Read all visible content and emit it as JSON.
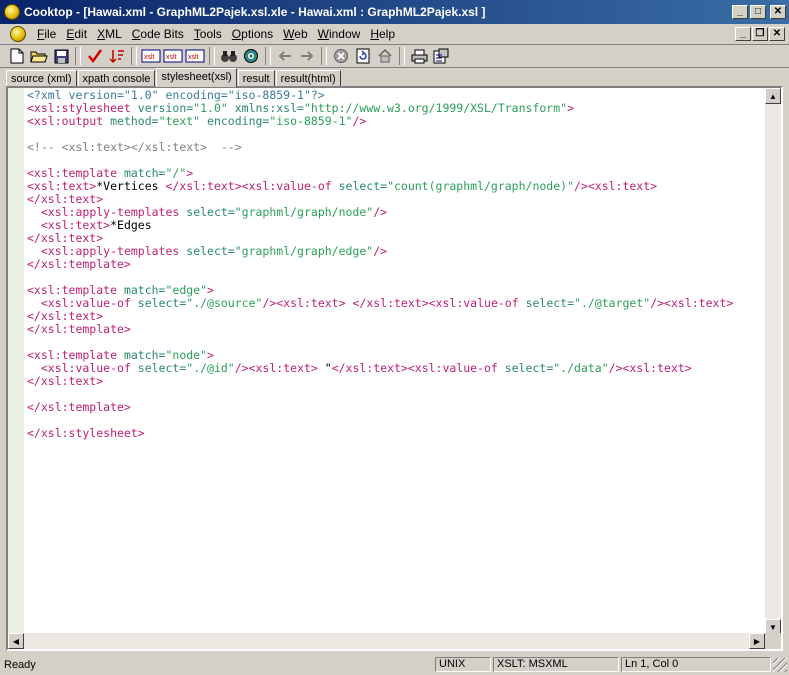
{
  "window": {
    "title": "Cooktop - [Hawai.xml - GraphML2Pajek.xsl.xle - Hawai.xml : GraphML2Pajek.xsl ]",
    "app_icon": "cooktop-logo-icon"
  },
  "menu": {
    "items": [
      "File",
      "Edit",
      "XML",
      "Code Bits",
      "Tools",
      "Options",
      "Web",
      "Window",
      "Help"
    ]
  },
  "toolbar": {
    "xslt_label": "xslt"
  },
  "tabs": [
    {
      "label": "source (xml)",
      "active": false
    },
    {
      "label": "xpath console",
      "active": false
    },
    {
      "label": "stylesheet(xsl)",
      "active": true
    },
    {
      "label": "result",
      "active": false
    },
    {
      "label": "result(html)",
      "active": false
    }
  ],
  "editor": {
    "lines": [
      [
        [
          "pi",
          "<?xml version=\"1.0\" encoding=\"iso-8859-1\"?>"
        ]
      ],
      [
        [
          "tag",
          "<xsl:stylesheet "
        ],
        [
          "attr",
          "version="
        ],
        [
          "str",
          "\"1.0\" "
        ],
        [
          "attr",
          "xmlns:xsl="
        ],
        [
          "str",
          "\"http://www.w3.org/1999/XSL/Transform\""
        ],
        [
          "tag",
          ">"
        ]
      ],
      [
        [
          "tag",
          "<xsl:output "
        ],
        [
          "attr",
          "method="
        ],
        [
          "str",
          "\"text\" "
        ],
        [
          "attr",
          "encoding="
        ],
        [
          "str",
          "\"iso-8859-1\""
        ],
        [
          "tag",
          "/>"
        ]
      ],
      [],
      [
        [
          "com",
          "<!-- <xsl:text></xsl:text>  -->"
        ]
      ],
      [],
      [
        [
          "tag",
          "<xsl:template "
        ],
        [
          "attr",
          "match="
        ],
        [
          "str",
          "\"/\""
        ],
        [
          "tag",
          ">"
        ]
      ],
      [
        [
          "tag",
          "<xsl:text>"
        ],
        [
          "text",
          "*Vertices "
        ],
        [
          "tag",
          "</xsl:text><xsl:value-of "
        ],
        [
          "attr",
          "select="
        ],
        [
          "str",
          "\"count(graphml/graph/node)\""
        ],
        [
          "tag",
          "/><xsl:text>"
        ]
      ],
      [
        [
          "tag",
          "</xsl:text>"
        ]
      ],
      [
        [
          "text",
          "  "
        ],
        [
          "tag",
          "<xsl:apply-templates "
        ],
        [
          "attr",
          "select="
        ],
        [
          "str",
          "\"graphml/graph/node\""
        ],
        [
          "tag",
          "/>"
        ]
      ],
      [
        [
          "text",
          "  "
        ],
        [
          "tag",
          "<xsl:text>"
        ],
        [
          "text",
          "*Edges"
        ]
      ],
      [
        [
          "tag",
          "</xsl:text>"
        ]
      ],
      [
        [
          "text",
          "  "
        ],
        [
          "tag",
          "<xsl:apply-templates "
        ],
        [
          "attr",
          "select="
        ],
        [
          "str",
          "\"graphml/graph/edge\""
        ],
        [
          "tag",
          "/>"
        ]
      ],
      [
        [
          "tag",
          "</xsl:template>"
        ]
      ],
      [],
      [
        [
          "tag",
          "<xsl:template "
        ],
        [
          "attr",
          "match="
        ],
        [
          "str",
          "\"edge\""
        ],
        [
          "tag",
          ">"
        ]
      ],
      [
        [
          "text",
          "  "
        ],
        [
          "tag",
          "<xsl:value-of "
        ],
        [
          "attr",
          "select="
        ],
        [
          "str",
          "\"./@source\""
        ],
        [
          "tag",
          "/><xsl:text>"
        ],
        [
          "text",
          " "
        ],
        [
          "tag",
          "</xsl:text><xsl:value-of "
        ],
        [
          "attr",
          "select="
        ],
        [
          "str",
          "\"./@target\""
        ],
        [
          "tag",
          "/><xsl:text>"
        ]
      ],
      [
        [
          "tag",
          "</xsl:text>"
        ]
      ],
      [
        [
          "tag",
          "</xsl:template>"
        ]
      ],
      [],
      [
        [
          "tag",
          "<xsl:template "
        ],
        [
          "attr",
          "match="
        ],
        [
          "str",
          "\"node\""
        ],
        [
          "tag",
          ">"
        ]
      ],
      [
        [
          "text",
          "  "
        ],
        [
          "tag",
          "<xsl:value-of "
        ],
        [
          "attr",
          "select="
        ],
        [
          "str",
          "\"./@id\""
        ],
        [
          "tag",
          "/><xsl:text>"
        ],
        [
          "text",
          " \""
        ],
        [
          "tag",
          "</xsl:text><xsl:value-of "
        ],
        [
          "attr",
          "select="
        ],
        [
          "str",
          "\"./data\""
        ],
        [
          "tag",
          "/><xsl:text>"
        ]
      ],
      [
        [
          "tag",
          "</xsl:text>"
        ]
      ],
      [],
      [
        [
          "tag",
          "</xsl:template>"
        ]
      ],
      [],
      [
        [
          "tag",
          "</xsl:stylesheet>"
        ]
      ]
    ]
  },
  "status": {
    "ready": "Ready",
    "line_ending": "UNIX",
    "xslt_engine": "XSLT: MSXML",
    "cursor": "Ln 1, Col 0"
  }
}
